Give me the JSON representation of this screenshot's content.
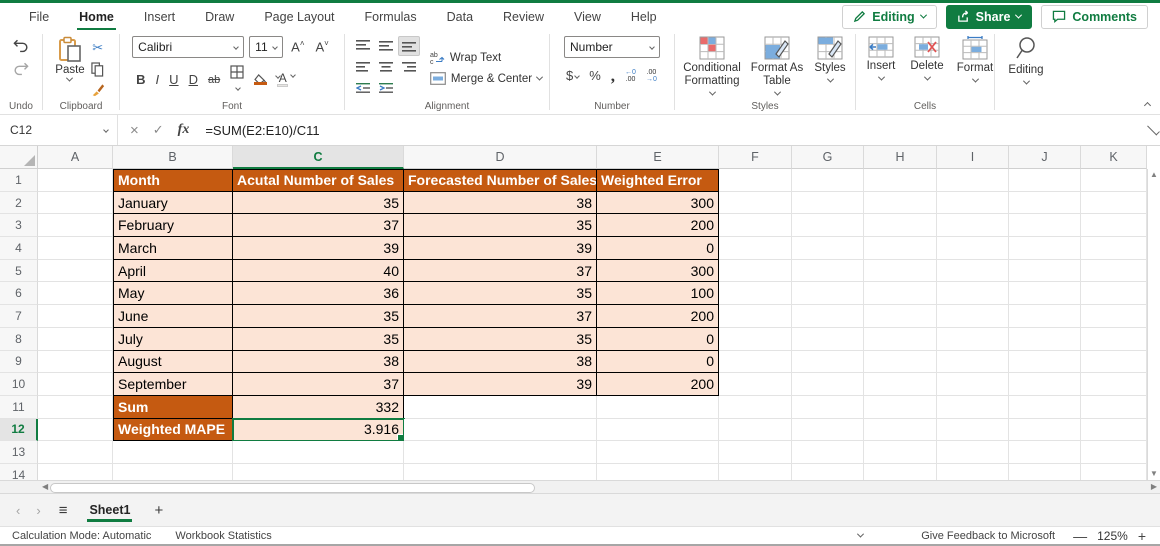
{
  "colors": {
    "accent_green": "#107C41",
    "header_orange": "#C55A11",
    "cell_fill_peach": "#FCE4D6",
    "selection_green": "#107C41"
  },
  "menu": {
    "tabs": [
      "File",
      "Home",
      "Insert",
      "Draw",
      "Page Layout",
      "Formulas",
      "Data",
      "Review",
      "View",
      "Help"
    ],
    "active_tab": "Home"
  },
  "top_actions": {
    "editing": "Editing",
    "share": "Share",
    "comments": "Comments"
  },
  "ribbon": {
    "groups": {
      "undo": "Undo",
      "clipboard": "Clipboard",
      "font": "Font",
      "alignment": "Alignment",
      "number": "Number",
      "styles": "Styles",
      "cells": "Cells"
    },
    "paste": "Paste",
    "font_name": "Calibri",
    "font_size": "11",
    "grow_font": "A",
    "shrink_font": "A",
    "bold": "B",
    "italic": "I",
    "underline": "U",
    "double_underline": "D",
    "strikethrough": "ab",
    "wrap_text": "Wrap Text",
    "merge_center": "Merge & Center",
    "number_format": "Number",
    "dollar": "$",
    "percent": "%",
    "comma": ",",
    "inc_decimal_top": "←0",
    "inc_decimal_bottom": ".00",
    "dec_decimal_top": ".00",
    "dec_decimal_bottom": "→0",
    "conditional_formatting": "Conditional Formatting",
    "format_as_table": "Format As Table",
    "styles": "Styles",
    "insert": "Insert",
    "delete": "Delete",
    "format": "Format",
    "editing": "Editing"
  },
  "formula_bar": {
    "name_box": "C12",
    "cancel": "×",
    "enter": "✓",
    "fx": "fx",
    "formula": "=SUM(E2:E10)/C11"
  },
  "grid": {
    "column_letters": [
      "A",
      "B",
      "C",
      "D",
      "E",
      "F",
      "G",
      "H",
      "I",
      "J",
      "K"
    ],
    "row_numbers": [
      1,
      2,
      3,
      4,
      5,
      6,
      7,
      8,
      9,
      10,
      11,
      12,
      13,
      14
    ],
    "selected_cell": "C12",
    "selected_column": "C",
    "selected_row": 12,
    "table": {
      "header": [
        "Month",
        "Acutal Number of Sales",
        "Forecasted Number of Sales",
        "Weighted Error"
      ],
      "rows": [
        {
          "month": "January",
          "actual": "35",
          "forecast": "38",
          "error": "300"
        },
        {
          "month": "February",
          "actual": "37",
          "forecast": "35",
          "error": "200"
        },
        {
          "month": "March",
          "actual": "39",
          "forecast": "39",
          "error": "0"
        },
        {
          "month": "April",
          "actual": "40",
          "forecast": "37",
          "error": "300"
        },
        {
          "month": "May",
          "actual": "36",
          "forecast": "35",
          "error": "100"
        },
        {
          "month": "June",
          "actual": "35",
          "forecast": "37",
          "error": "200"
        },
        {
          "month": "July",
          "actual": "35",
          "forecast": "35",
          "error": "0"
        },
        {
          "month": "August",
          "actual": "38",
          "forecast": "38",
          "error": "0"
        },
        {
          "month": "September",
          "actual": "37",
          "forecast": "39",
          "error": "200"
        }
      ],
      "sum_label": "Sum",
      "sum_value": "332",
      "mape_label": "Weighted MAPE",
      "mape_value": "3.916"
    }
  },
  "sheet_tabs": {
    "sheet_name": "Sheet1"
  },
  "status_bar": {
    "calculation_mode": "Calculation Mode: Automatic",
    "workbook_statistics": "Workbook Statistics",
    "feedback": "Give Feedback to Microsoft",
    "zoom_out": "—",
    "zoom_level": "125%",
    "zoom_in": "+"
  }
}
